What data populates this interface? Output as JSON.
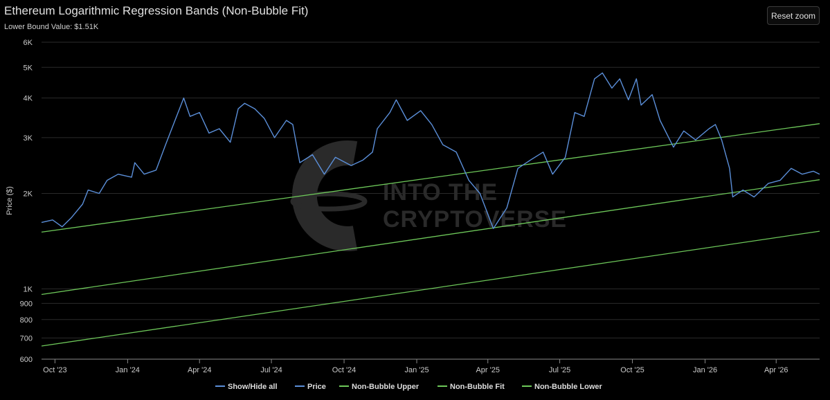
{
  "header": {
    "title": "Ethereum Logarithmic Regression Bands (Non-Bubble Fit)",
    "subtitle": "Lower Bound Value: $1.51K",
    "reset_label": "Reset zoom"
  },
  "watermark": {
    "line1": "INTO THE",
    "line2": "CRYPTOVERSE"
  },
  "legend": [
    {
      "label": "Show/Hide all",
      "color": "#5b8fd9"
    },
    {
      "label": "Price",
      "color": "#5b8fd9"
    },
    {
      "label": "Non-Bubble Upper",
      "color": "#6ec95a"
    },
    {
      "label": "Non-Bubble Fit",
      "color": "#6ec95a"
    },
    {
      "label": "Non-Bubble Lower",
      "color": "#6ec95a"
    }
  ],
  "chart_data": {
    "type": "line",
    "title": "Ethereum Logarithmic Regression Bands (Non-Bubble Fit)",
    "subtitle": "Lower Bound Value: $1.51K",
    "xlabel": "",
    "ylabel": "Price ($)",
    "y_scale": "log",
    "ylim": [
      600,
      6000
    ],
    "xlim": [
      "2023-09-14",
      "2026-05-26"
    ],
    "grid": true,
    "legend_position": "bottom",
    "y_ticks": [
      {
        "value": 600,
        "label": "600"
      },
      {
        "value": 700,
        "label": "700"
      },
      {
        "value": 800,
        "label": "800"
      },
      {
        "value": 900,
        "label": "900"
      },
      {
        "value": 1000,
        "label": "1K"
      },
      {
        "value": 2000,
        "label": "2K"
      },
      {
        "value": 3000,
        "label": "3K"
      },
      {
        "value": 4000,
        "label": "4K"
      },
      {
        "value": 5000,
        "label": "5K"
      },
      {
        "value": 6000,
        "label": "6K"
      }
    ],
    "x_ticks": [
      {
        "date": "2023-10-01",
        "label": "Oct '23"
      },
      {
        "date": "2024-01-01",
        "label": "Jan '24"
      },
      {
        "date": "2024-04-01",
        "label": "Apr '24"
      },
      {
        "date": "2024-07-01",
        "label": "Jul '24"
      },
      {
        "date": "2024-10-01",
        "label": "Oct '24"
      },
      {
        "date": "2025-01-01",
        "label": "Jan '25"
      },
      {
        "date": "2025-04-01",
        "label": "Apr '25"
      },
      {
        "date": "2025-07-01",
        "label": "Jul '25"
      },
      {
        "date": "2025-10-01",
        "label": "Oct '25"
      },
      {
        "date": "2026-01-01",
        "label": "Jan '26"
      },
      {
        "date": "2026-04-01",
        "label": "Apr '26"
      }
    ],
    "series": [
      {
        "name": "Price",
        "color": "#5b8fd9",
        "points": [
          [
            "2023-09-14",
            1620
          ],
          [
            "2023-09-28",
            1650
          ],
          [
            "2023-10-10",
            1570
          ],
          [
            "2023-10-22",
            1680
          ],
          [
            "2023-11-05",
            1850
          ],
          [
            "2023-11-12",
            2050
          ],
          [
            "2023-11-26",
            2000
          ],
          [
            "2023-12-06",
            2200
          ],
          [
            "2023-12-20",
            2300
          ],
          [
            "2024-01-06",
            2250
          ],
          [
            "2024-01-10",
            2500
          ],
          [
            "2024-01-22",
            2300
          ],
          [
            "2024-02-06",
            2370
          ],
          [
            "2024-02-18",
            2850
          ],
          [
            "2024-03-01",
            3400
          ],
          [
            "2024-03-12",
            4000
          ],
          [
            "2024-03-20",
            3500
          ],
          [
            "2024-04-01",
            3600
          ],
          [
            "2024-04-13",
            3100
          ],
          [
            "2024-04-26",
            3200
          ],
          [
            "2024-05-10",
            2900
          ],
          [
            "2024-05-20",
            3700
          ],
          [
            "2024-05-28",
            3850
          ],
          [
            "2024-06-10",
            3700
          ],
          [
            "2024-06-22",
            3450
          ],
          [
            "2024-07-05",
            3000
          ],
          [
            "2024-07-20",
            3400
          ],
          [
            "2024-07-28",
            3300
          ],
          [
            "2024-08-06",
            2500
          ],
          [
            "2024-08-22",
            2650
          ],
          [
            "2024-09-06",
            2300
          ],
          [
            "2024-09-20",
            2600
          ],
          [
            "2024-10-10",
            2450
          ],
          [
            "2024-10-25",
            2550
          ],
          [
            "2024-11-06",
            2700
          ],
          [
            "2024-11-12",
            3200
          ],
          [
            "2024-11-28",
            3600
          ],
          [
            "2024-12-06",
            3950
          ],
          [
            "2024-12-20",
            3400
          ],
          [
            "2025-01-06",
            3650
          ],
          [
            "2025-01-20",
            3300
          ],
          [
            "2025-02-03",
            2850
          ],
          [
            "2025-02-20",
            2700
          ],
          [
            "2025-03-08",
            2200
          ],
          [
            "2025-03-22",
            2000
          ],
          [
            "2025-04-08",
            1550
          ],
          [
            "2025-04-25",
            1800
          ],
          [
            "2025-05-09",
            2400
          ],
          [
            "2025-05-25",
            2550
          ],
          [
            "2025-06-10",
            2700
          ],
          [
            "2025-06-22",
            2300
          ],
          [
            "2025-07-08",
            2600
          ],
          [
            "2025-07-20",
            3600
          ],
          [
            "2025-08-01",
            3500
          ],
          [
            "2025-08-14",
            4600
          ],
          [
            "2025-08-24",
            4800
          ],
          [
            "2025-09-05",
            4300
          ],
          [
            "2025-09-15",
            4600
          ],
          [
            "2025-09-26",
            3950
          ],
          [
            "2025-10-06",
            4600
          ],
          [
            "2025-10-12",
            3800
          ],
          [
            "2025-10-26",
            4100
          ],
          [
            "2025-11-05",
            3400
          ],
          [
            "2025-11-22",
            2800
          ],
          [
            "2025-12-05",
            3150
          ],
          [
            "2025-12-20",
            2950
          ],
          [
            "2026-01-06",
            3200
          ],
          [
            "2026-01-14",
            3300
          ],
          [
            "2026-01-22",
            2950
          ],
          [
            "2026-02-01",
            2400
          ],
          [
            "2026-02-05",
            1950
          ],
          [
            "2026-02-18",
            2050
          ],
          [
            "2026-03-04",
            1950
          ],
          [
            "2026-03-22",
            2150
          ],
          [
            "2026-04-06",
            2200
          ],
          [
            "2026-04-20",
            2400
          ],
          [
            "2026-05-04",
            2300
          ],
          [
            "2026-05-18",
            2350
          ],
          [
            "2026-05-26",
            2300
          ]
        ]
      },
      {
        "name": "Non-Bubble Upper",
        "color": "#6ec95a",
        "points": [
          [
            "2023-09-14",
            1510
          ],
          [
            "2026-05-26",
            3320
          ]
        ]
      },
      {
        "name": "Non-Bubble Fit",
        "color": "#6ec95a",
        "points": [
          [
            "2023-09-14",
            960
          ],
          [
            "2026-05-26",
            2210
          ]
        ]
      },
      {
        "name": "Non-Bubble Lower",
        "color": "#6ec95a",
        "points": [
          [
            "2023-09-14",
            660
          ],
          [
            "2026-05-26",
            1520
          ]
        ]
      }
    ]
  }
}
